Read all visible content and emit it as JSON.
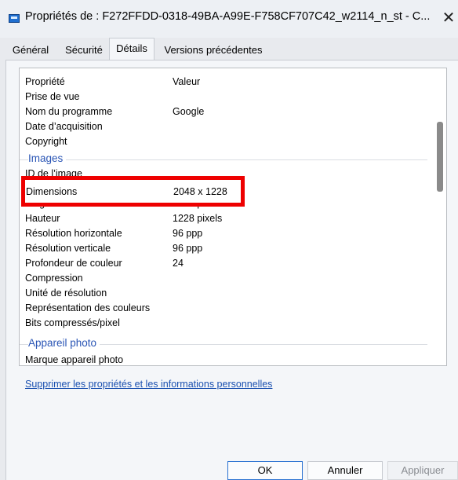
{
  "window": {
    "title": "Propriétés de : F272FFDD-0318-49BA-A99E-F758CF707C42_w2114_n_st - C...",
    "close_glyph": "✕",
    "accent_color": "#1f6fd0",
    "icon": "file-properties-icon"
  },
  "tabs": [
    {
      "label": "Général"
    },
    {
      "label": "Sécurité"
    },
    {
      "label": "Détails",
      "active": true
    },
    {
      "label": "Versions précédentes"
    }
  ],
  "details": {
    "headers": {
      "property": "Propriété",
      "value": "Valeur"
    },
    "rows": [
      {
        "property": "Prise de vue",
        "value": ""
      },
      {
        "property": "Nom du programme",
        "value": "Google"
      },
      {
        "property": "Date d’acquisition",
        "value": ""
      },
      {
        "property": "Copyright",
        "value": ""
      }
    ],
    "groups": [
      {
        "label": "Images",
        "rows": [
          {
            "property": "ID de l’image",
            "value": ""
          },
          {
            "property": "Dimensions",
            "value": "2048 x 1228"
          },
          {
            "property": "Largeur",
            "value": "2048 pixels"
          },
          {
            "property": "Hauteur",
            "value": "1228 pixels"
          },
          {
            "property": "Résolution horizontale",
            "value": "96 ppp"
          },
          {
            "property": "Résolution verticale",
            "value": "96 ppp"
          },
          {
            "property": "Profondeur de couleur",
            "value": "24"
          },
          {
            "property": "Compression",
            "value": ""
          },
          {
            "property": "Unité de résolution",
            "value": ""
          },
          {
            "property": "Représentation des couleurs",
            "value": ""
          },
          {
            "property": "Bits compressés/pixel",
            "value": ""
          }
        ]
      },
      {
        "label": "Appareil photo",
        "rows": [
          {
            "property": "Marque appareil photo",
            "value": ""
          }
        ]
      }
    ],
    "highlight_color": "#ee0000"
  },
  "remove_properties_link": "Supprimer les propriétés et les informations personnelles",
  "buttons": {
    "ok": "OK",
    "cancel": "Annuler",
    "apply": "Appliquer"
  }
}
